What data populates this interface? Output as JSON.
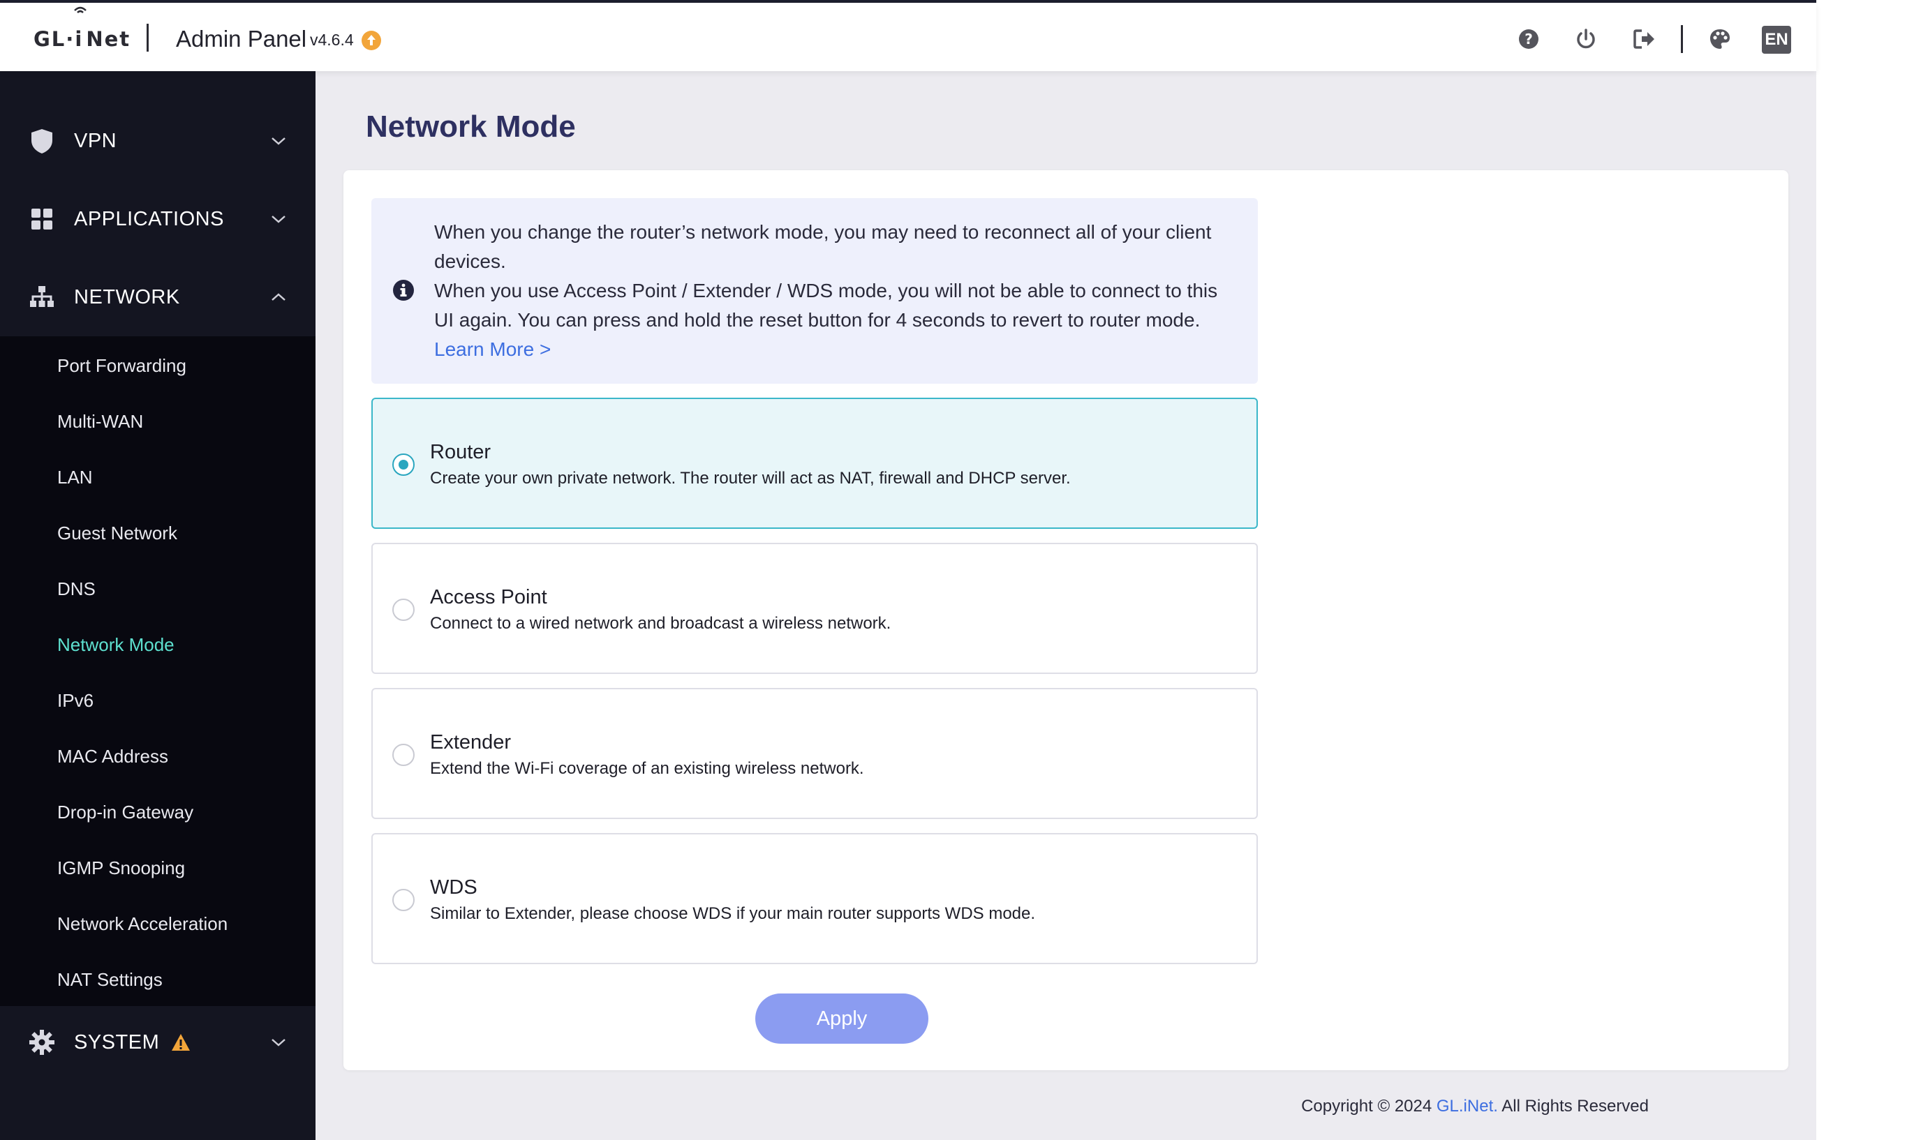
{
  "header": {
    "logo_left": "GL·",
    "logo_right": "Net",
    "title": "Admin Panel",
    "version": "v4.6.4",
    "language": "EN",
    "icons": [
      "help-icon",
      "power-icon",
      "logout-icon",
      "theme-palette-icon"
    ]
  },
  "sidebar": {
    "main_items": [
      {
        "label": "VPN",
        "icon": "shield-icon",
        "expanded": false
      },
      {
        "label": "APPLICATIONS",
        "icon": "apps-grid-icon",
        "expanded": false
      },
      {
        "label": "NETWORK",
        "icon": "network-tree-icon",
        "expanded": true
      },
      {
        "label": "SYSTEM",
        "icon": "gear-icon",
        "expanded": false,
        "warning": true
      }
    ],
    "network_submenu": [
      "Port Forwarding",
      "Multi-WAN",
      "LAN",
      "Guest Network",
      "DNS",
      "Network Mode",
      "IPv6",
      "MAC Address",
      "Drop-in Gateway",
      "IGMP Snooping",
      "Network Acceleration",
      "NAT Settings"
    ],
    "active_submenu": "Network Mode"
  },
  "main": {
    "page_title": "Network Mode",
    "notice": {
      "line1": "When you change the router’s network mode, you may need to reconnect all of your client",
      "line2": "devices.",
      "line3": "When you use Access Point / Extender / WDS mode, you will not be able to connect to this",
      "line4": "UI again. You can press and hold the reset button for 4 seconds to revert to router mode.",
      "learn_more": "Learn More >"
    },
    "modes": [
      {
        "title": "Router",
        "desc": "Create your own private network. The router will act as NAT, firewall and DHCP server.",
        "selected": true
      },
      {
        "title": "Access Point",
        "desc": "Connect to a wired network and broadcast a wireless network.",
        "selected": false
      },
      {
        "title": "Extender",
        "desc": "Extend the Wi-Fi coverage of an existing wireless network.",
        "selected": false
      },
      {
        "title": "WDS",
        "desc": "Similar to Extender, please choose WDS if your main router supports WDS mode.",
        "selected": false
      }
    ],
    "apply_label": "Apply",
    "copyright_prefix": "Copyright © 2024 ",
    "copyright_brand": "GL.iNet.",
    "copyright_suffix": " All Rights Reserved"
  },
  "colors": {
    "sidebar_bg": "#141521",
    "submenu_bg": "#080810",
    "active_item": "#5ee0cf",
    "title": "#2e3061",
    "selected_border": "#3bb7c9",
    "selected_bg": "#e8f6f9",
    "apply_button": "#8b9cf1",
    "link": "#3d6ee0",
    "update_badge": "#f2a53a",
    "warning": "#f2a53a"
  }
}
